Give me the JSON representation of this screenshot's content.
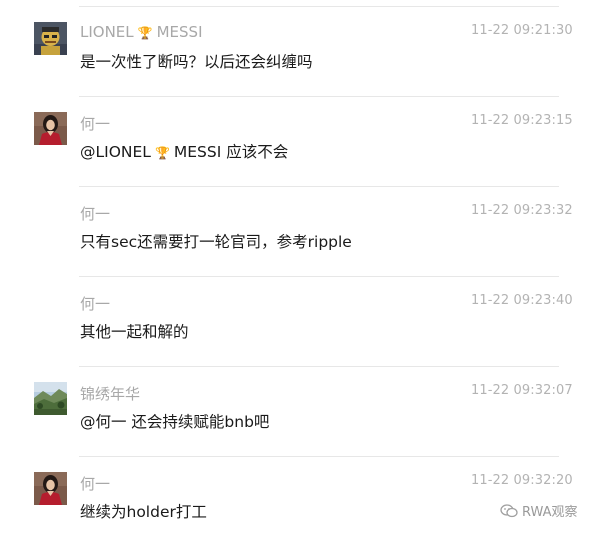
{
  "comments": [
    {
      "author_before": "LIONEL",
      "author_after": "MESSI",
      "author_badge": "trophy-icon",
      "avatar": "cartoon-avatar",
      "time": "11-22 09:21:30",
      "text": "是一次性了断吗？以后还会纠缠吗"
    },
    {
      "author": "何一",
      "avatar": "woman-red-dress-avatar",
      "time": "11-22 09:23:15",
      "text_before": "@LIONEL",
      "text_after": "MESSI 应该不会",
      "text_badge": "trophy-icon"
    },
    {
      "author": "何一",
      "time": "11-22 09:23:32",
      "text": "只有sec还需要打一轮官司，参考ripple"
    },
    {
      "author": "何一",
      "time": "11-22 09:23:40",
      "text": "其他一起和解的"
    },
    {
      "author": "锦绣年华",
      "avatar": "landscape-avatar",
      "time": "11-22 09:32:07",
      "text": "@何一 还会持续赋能bnb吧"
    },
    {
      "author": "何一",
      "avatar": "woman-red-dress-avatar",
      "time": "11-22 09:32:20",
      "text": "继续为holder打工"
    }
  ],
  "watermark": {
    "text": "RWA观察",
    "icon": "wechat-channel-icon"
  },
  "colors": {
    "name": "#a8a8a8",
    "time": "#b3b3b3",
    "text": "#1a1a1a",
    "divider": "#e7e7e7",
    "trophy": "#c9992c"
  }
}
